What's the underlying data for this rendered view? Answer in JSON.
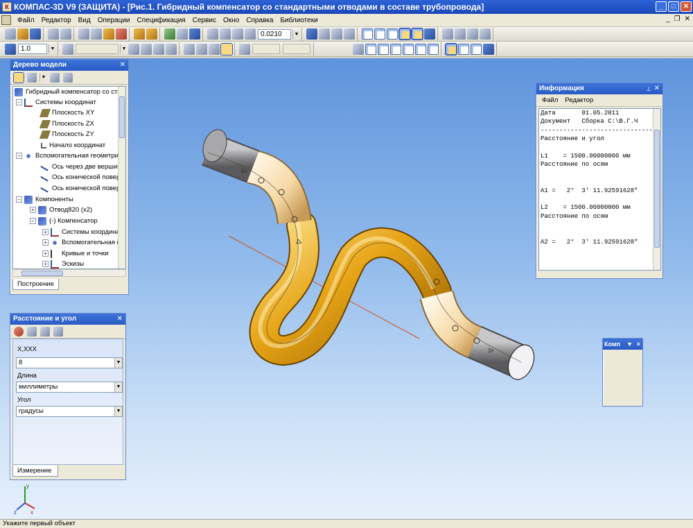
{
  "window": {
    "title": "КОМПАС-3D V9 (ЗАЩИТА) - [Рис.1. Гибридный компенсатор со стандартными отводами в составе трубопровода]"
  },
  "menu": [
    "Файл",
    "Редактор",
    "Вид",
    "Операции",
    "Спецификация",
    "Сервис",
    "Окно",
    "Справка",
    "Библиотеки"
  ],
  "toolbar": {
    "zoom_value": "0.0210",
    "line_step": "1.0"
  },
  "tree": {
    "title": "Дерево модели",
    "items": [
      "Гибридный компенсатор со станда",
      "Системы координат",
      "Плоскость XY",
      "Плоскость ZX",
      "Плоскость ZY",
      "Начало координат",
      "Вспомогательная геометри",
      "Ось через две вершин",
      "Ось конической повер",
      "Ось конической повер",
      "Компоненты",
      "Отвод820 (x2)",
      "(-) Компенсатор",
      "Системы координа",
      "Вспомогательная г",
      "Кривые и точки",
      "Эскизы"
    ],
    "tab": "Построение"
  },
  "measure": {
    "title": "Расстояние и угол",
    "precision_label": "X,XXX",
    "precision_value": "8",
    "length_label": "Длина",
    "length_value": "миллиметры",
    "angle_label": "Угол",
    "angle_value": "градусы",
    "tab": "Измерение"
  },
  "info": {
    "title": "Информация",
    "menu": [
      "Файл",
      "Редактор"
    ],
    "lines": [
      "Дата       01.05.2011",
      "Документ   Сборка C:\\В.Г.Ч",
      "-------------------------------",
      "Расстояние и угол",
      "",
      "L1    = 1500.00000000 мм",
      "Расстояние по осям",
      "",
      "",
      "A1 =   2°  3' 11.92591628\"",
      "",
      "L2    = 1500.00000000 мм",
      "Расстояние по осям",
      "",
      "",
      "A2 =   2°  3' 11.92591628\""
    ]
  },
  "compact_panel": {
    "title": "Комп"
  },
  "axes_labels": {
    "x": "x",
    "y": "y",
    "z": "z"
  },
  "status": "Укажите первый объект",
  "colors": {
    "pipe_gold": "#e6a416",
    "pipe_cream": "#f7d9a6",
    "pipe_gray": "#8a8a8c",
    "title_blue": "#2a5bc4",
    "axis_line": "#d2541e"
  }
}
